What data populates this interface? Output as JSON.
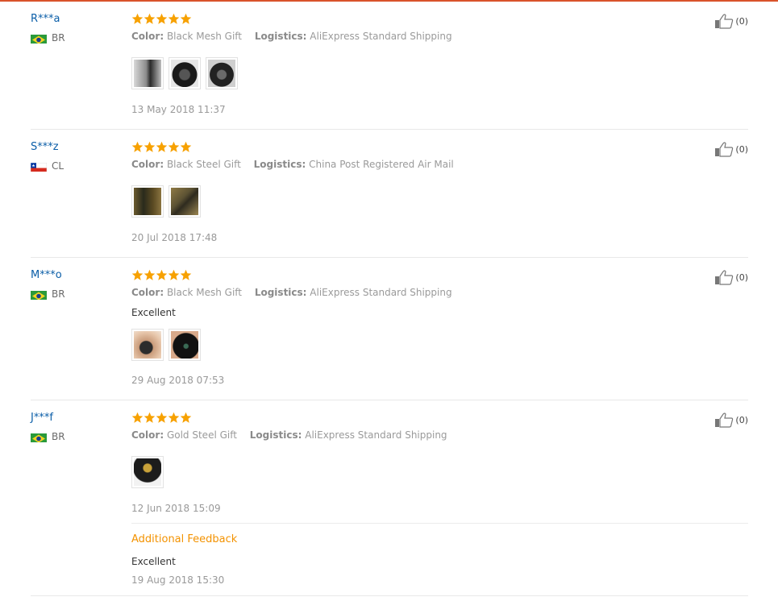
{
  "colors": {
    "star": "#f7a100",
    "link": "#0b5ea8",
    "accent": "#f39200"
  },
  "labels": {
    "color": "Color:",
    "logistics": "Logistics:"
  },
  "reviews": [
    {
      "user": "R***a",
      "country": "BR",
      "flag": "brazil-flag-icon",
      "rating": 5,
      "color": "Black Mesh Gift",
      "logistics": "AliExpress Standard Shipping",
      "comment": "",
      "date": "13 May 2018 11:37",
      "helpful": "(0)",
      "photos": [
        "review-photo",
        "review-photo",
        "review-photo"
      ]
    },
    {
      "user": "S***z",
      "country": "CL",
      "flag": "chile-flag-icon",
      "rating": 5,
      "color": "Black Steel Gift",
      "logistics": "China Post Registered Air Mail",
      "comment": "",
      "date": "20 Jul 2018 17:48",
      "helpful": "(0)",
      "photos": [
        "review-photo",
        "review-photo"
      ]
    },
    {
      "user": "M***o",
      "country": "BR",
      "flag": "brazil-flag-icon",
      "rating": 5,
      "color": "Black Mesh Gift",
      "logistics": "AliExpress Standard Shipping",
      "comment": "Excellent",
      "date": "29 Aug 2018 07:53",
      "helpful": "(0)",
      "photos": [
        "review-photo",
        "review-photo"
      ]
    },
    {
      "user": "J***f",
      "country": "BR",
      "flag": "brazil-flag-icon",
      "rating": 5,
      "color": "Gold Steel Gift",
      "logistics": "AliExpress Standard Shipping",
      "comment": "",
      "date": "12 Jun 2018 15:09",
      "helpful": "(0)",
      "photos": [
        "review-photo"
      ],
      "additional": {
        "title": "Additional Feedback",
        "text": "Excellent",
        "date": "19 Aug 2018 15:30"
      }
    }
  ]
}
